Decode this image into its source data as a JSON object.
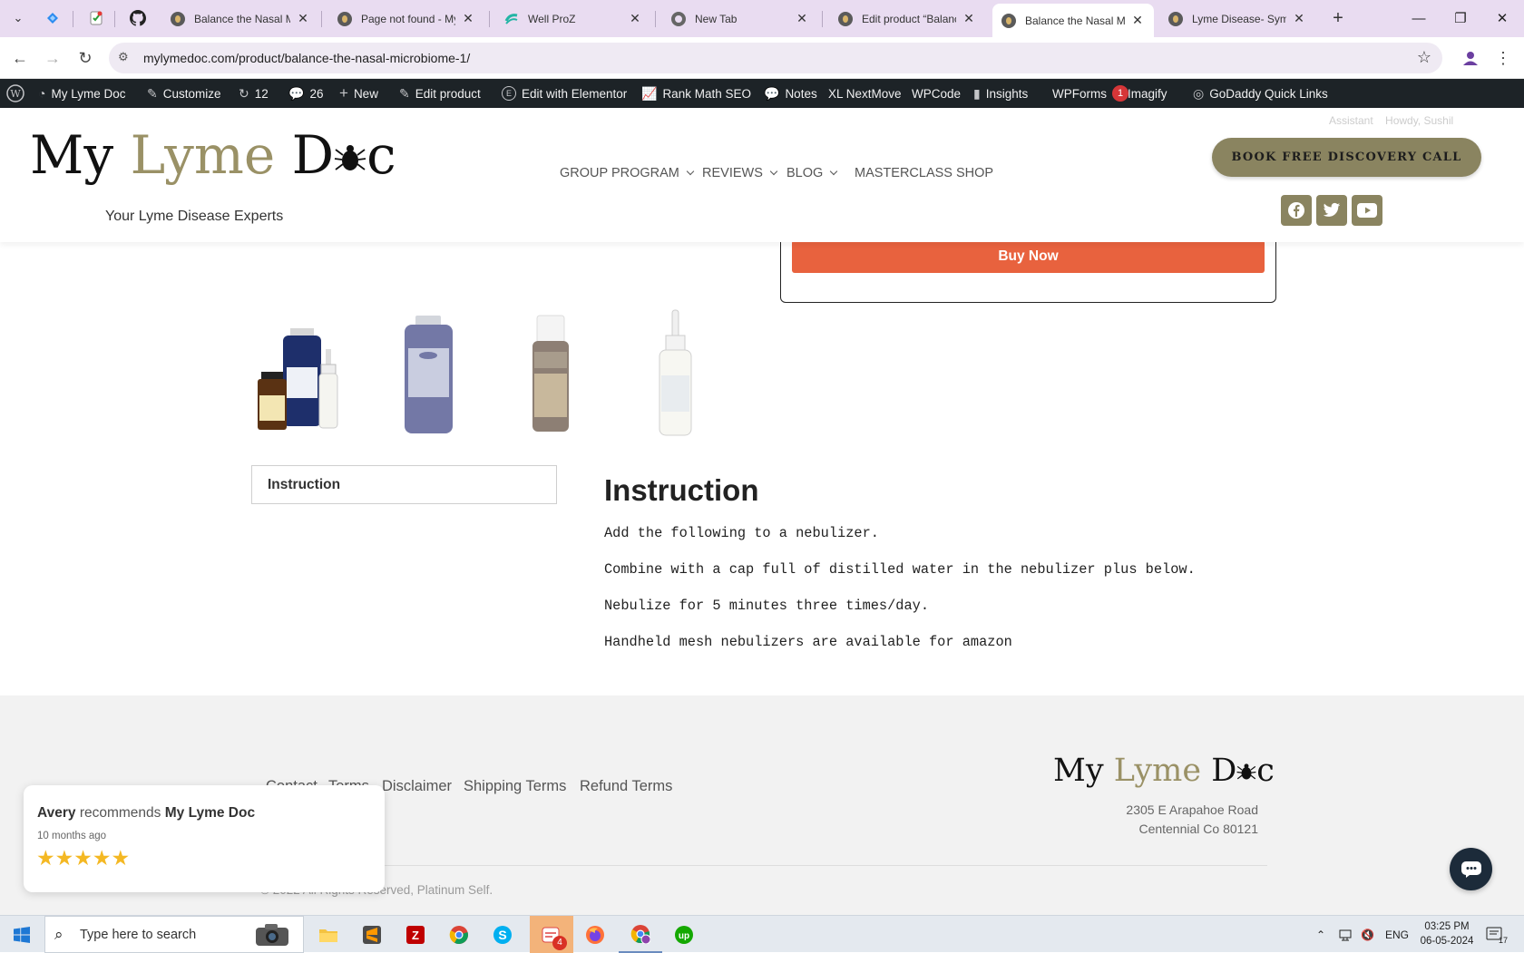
{
  "browser": {
    "pinned_tabs": [
      "tab-icon-1",
      "tab-icon-2",
      "github-icon"
    ],
    "tabs": [
      {
        "title": "Balance the Nasal Mi",
        "active": false
      },
      {
        "title": "Page not found - My",
        "active": false
      },
      {
        "title": "Well ProZ",
        "active": false
      },
      {
        "title": "New Tab",
        "active": false
      },
      {
        "title": "Edit product “Balance",
        "active": false
      },
      {
        "title": "Balance the Nasal Mi",
        "active": true
      },
      {
        "title": "Lyme Disease- Sympt",
        "active": false
      }
    ],
    "url": "mylymedoc.com/product/balance-the-nasal-microbiome-1/"
  },
  "admin_bar": {
    "site_name": "My Lyme Doc",
    "customize": "Customize",
    "updates": "12",
    "comments": "26",
    "new": "New",
    "edit_product": "Edit product",
    "elementor": "Edit with Elementor",
    "rank_math": "Rank Math SEO",
    "notes": "Notes",
    "xl_nextmove": "XL NextMove",
    "wpcode": "WPCode",
    "insights": "Insights",
    "wpforms": "WPForms",
    "wpforms_badge": "1",
    "imagify": "Imagify",
    "godaddy": "GoDaddy Quick Links"
  },
  "header": {
    "logo": {
      "my": "My",
      "lyme": "Lyme",
      "doc": "D",
      "doc_end": "c"
    },
    "tagline": "Your Lyme Disease Experts",
    "top_right": "Assistant    Howdy, Sushil",
    "nav": [
      {
        "label": "GROUP PROGRAM",
        "has_dropdown": true
      },
      {
        "label": "REVIEWS",
        "has_dropdown": true
      },
      {
        "label": "BLOG",
        "has_dropdown": true
      },
      {
        "label": "MASTERCLASS",
        "has_dropdown": false
      },
      {
        "label": "SHOP",
        "has_dropdown": false
      }
    ],
    "cta": "BOOK FREE DISCOVERY CALL",
    "social": [
      "facebook-icon",
      "twitter-icon",
      "youtube-icon"
    ],
    "accent_color": "#8a8460"
  },
  "product": {
    "buy_now": "Buy Now",
    "buy_color": "#e8623e",
    "thumbnails": [
      "product-bundle",
      "colloidal-silver",
      "thyme-oil",
      "nasal-spray"
    ]
  },
  "instruction": {
    "tab_label": "Instruction",
    "title": "Instruction",
    "lines": [
      "Add the following to a nebulizer.",
      "Combine with a cap full of distilled water in the nebulizer plus below.",
      "Nebulize for 5 minutes three times/day.",
      "Handheld mesh nebulizers are available for amazon"
    ]
  },
  "footer": {
    "links": [
      "Contact",
      "Terms",
      "Disclaimer",
      "Shipping Terms",
      "Refund Terms"
    ],
    "address_line1": "2305 E Arapahoe Road",
    "address_line2": "Centennial Co 80121",
    "copyright": "© 2022 All Rights Reserved, Platinum Self."
  },
  "review_widget": {
    "reviewer": "Avery",
    "recommends": "recommends",
    "business": "My Lyme Doc",
    "time_ago": "10 months ago",
    "stars": "★★★★★",
    "rating": 5
  },
  "taskbar": {
    "search_placeholder": "Type here to search",
    "apps": [
      "file-explorer",
      "sublime-text",
      "filezilla",
      "chrome",
      "skype",
      "notes-app",
      "firefox",
      "chrome-profile",
      "upwork"
    ],
    "notes_badge": "4",
    "language": "ENG",
    "time": "03:25 PM",
    "date": "06-05-2024",
    "notification_count": "17"
  }
}
